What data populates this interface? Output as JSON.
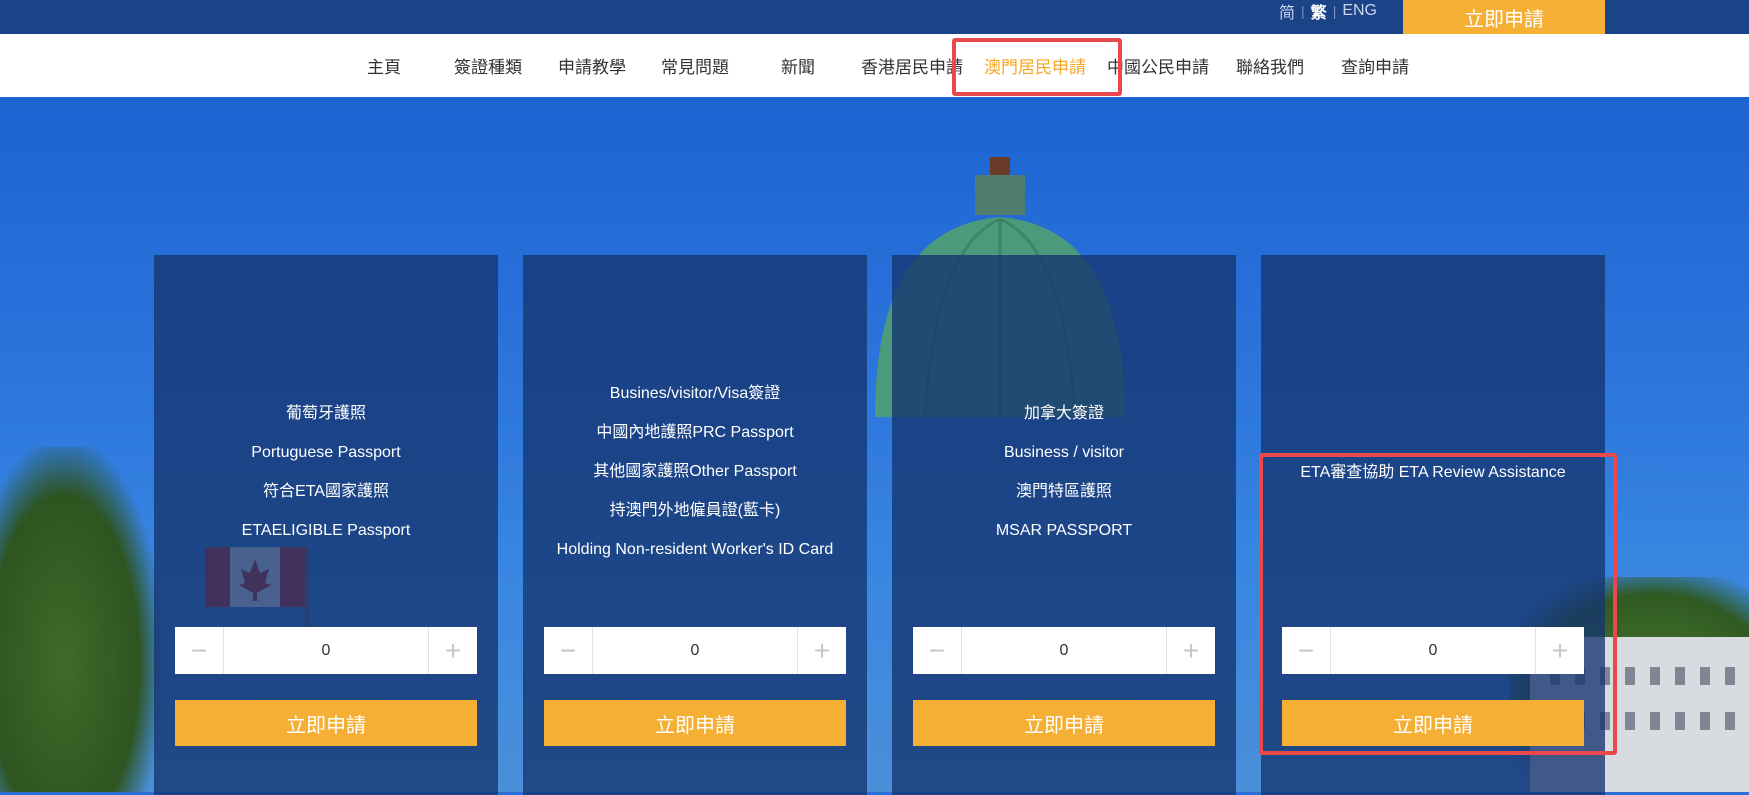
{
  "header": {
    "lang": {
      "simplified": "简",
      "traditional": "繁",
      "english": "ENG",
      "separator": "|"
    },
    "apply_now": "立即申請"
  },
  "nav": {
    "items": [
      "主頁",
      "簽證種類",
      "申請教學",
      "常見問題",
      "新聞",
      "香港居民申請",
      "澳門居民申請",
      "中國公民申請",
      "聯絡我們",
      "查詢申請"
    ],
    "active_index": 6
  },
  "cards": [
    {
      "lines": [
        "葡萄牙護照",
        "Portuguese Passport",
        "符合ETA國家護照",
        "ETAELIGIBLE Passport"
      ],
      "quantity": "0",
      "apply": "立即申請"
    },
    {
      "lines": [
        "Busines/visitor/Visa簽證",
        "中國內地護照PRC Passport",
        "其他國家護照Other Passport",
        "持澳門外地僱員證(藍卡)",
        "Holding Non-resident Worker's ID Card"
      ],
      "quantity": "0",
      "apply": "立即申請"
    },
    {
      "lines": [
        "加拿大簽證",
        "Business / visitor",
        "澳門特區護照",
        "MSAR PASSPORT"
      ],
      "quantity": "0",
      "apply": "立即申請"
    },
    {
      "lines": [
        "ETA審查協助 ETA Review Assistance"
      ],
      "quantity": "0",
      "apply": "立即申請"
    }
  ],
  "stepper": {
    "minus": "−",
    "plus": "+"
  },
  "colors": {
    "topbar": "#1b4488",
    "accent": "#f6af35",
    "nav_active": "#f6a623",
    "highlight": "#e9494d"
  }
}
